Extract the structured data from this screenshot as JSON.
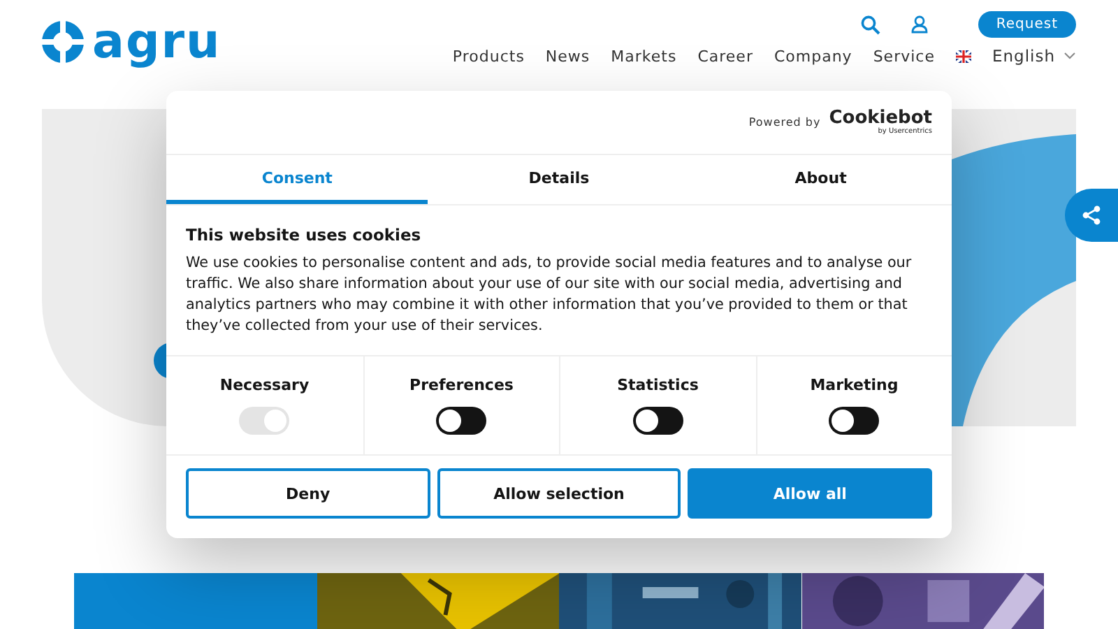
{
  "header": {
    "logo": "agru",
    "request_button": "Request",
    "nav": [
      "Products",
      "News",
      "Markets",
      "Career",
      "Company",
      "Service"
    ],
    "language": "English"
  },
  "tiles": [
    {
      "kind": "plain",
      "color": "#0a85cf"
    },
    {
      "kind": "picture",
      "color": "#e8c200"
    },
    {
      "kind": "picture",
      "color": "#1f4f78"
    },
    {
      "kind": "picture",
      "color": "#5a4a8c"
    }
  ],
  "cookie_dialog": {
    "powered_by": "Powered by",
    "brand": "Cookiebot",
    "brand_sub": "by Usercentrics",
    "tabs": [
      {
        "label": "Consent",
        "selected": true
      },
      {
        "label": "Details",
        "selected": false
      },
      {
        "label": "About",
        "selected": false
      }
    ],
    "title": "This website uses cookies",
    "text": "We use cookies to personalise content and ads, to provide social media features and to analyse our traffic. We also share information about your use of our site with our social media, advertising and analytics partners who may combine it with other information that you’ve provided to them or that they’ve collected from your use of their services.",
    "categories": [
      {
        "label": "Necessary",
        "on": true,
        "disabled": true
      },
      {
        "label": "Preferences",
        "on": false,
        "disabled": false
      },
      {
        "label": "Statistics",
        "on": false,
        "disabled": false
      },
      {
        "label": "Marketing",
        "on": false,
        "disabled": false
      }
    ],
    "buttons": [
      {
        "label": "Deny",
        "kind": "outline"
      },
      {
        "label": "Allow selection",
        "kind": "outline"
      },
      {
        "label": "Allow all",
        "kind": "primary"
      }
    ]
  }
}
